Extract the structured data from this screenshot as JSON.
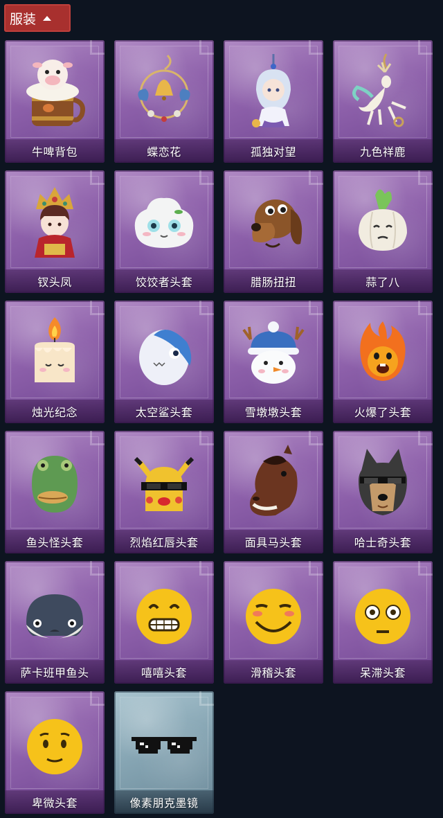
{
  "header": {
    "title": "服装"
  },
  "items": [
    {
      "label": "牛啤背包",
      "icon": "cow-beer-backpack-icon"
    },
    {
      "label": "蝶恋花",
      "icon": "butterfly-bell-charm-icon"
    },
    {
      "label": "孤独对望",
      "icon": "lonely-gaze-doll-icon"
    },
    {
      "label": "九色祥鹿",
      "icon": "auspicious-deer-icon"
    },
    {
      "label": "钗头凤",
      "icon": "phoenix-crown-doll-icon"
    },
    {
      "label": "饺饺者头套",
      "icon": "dumpling-head-icon"
    },
    {
      "label": "腊肠扭扭",
      "icon": "dachshund-head-icon"
    },
    {
      "label": "蒜了八",
      "icon": "garlic-head-icon"
    },
    {
      "label": "烛光纪念",
      "icon": "candle-head-icon"
    },
    {
      "label": "太空鲨头套",
      "icon": "space-shark-head-icon"
    },
    {
      "label": "雪墩墩头套",
      "icon": "snowman-head-icon"
    },
    {
      "label": "火爆了头套",
      "icon": "fire-head-icon"
    },
    {
      "label": "鱼头怪头套",
      "icon": "fish-monster-head-icon"
    },
    {
      "label": "烈焰红唇头套",
      "icon": "red-lips-mask-icon"
    },
    {
      "label": "面具马头套",
      "icon": "horse-mask-icon"
    },
    {
      "label": "哈士奇头套",
      "icon": "husky-head-icon"
    },
    {
      "label": "萨卡班甲鱼头",
      "icon": "sacabambaspis-head-icon"
    },
    {
      "label": "嘻嘻头套",
      "icon": "grin-emoji-head-icon"
    },
    {
      "label": "滑稽头套",
      "icon": "funny-emoji-head-icon"
    },
    {
      "label": "呆滞头套",
      "icon": "dazed-emoji-head-icon"
    },
    {
      "label": "卑微头套",
      "icon": "humble-emoji-head-icon"
    },
    {
      "label": "像素朋克墨镜",
      "icon": "pixel-sunglasses-icon"
    }
  ],
  "colors": {
    "background": "#0d1420",
    "header_tab": "#a8302e",
    "card_purple": "#8d60aa",
    "card_blue": "#87a6b4"
  }
}
